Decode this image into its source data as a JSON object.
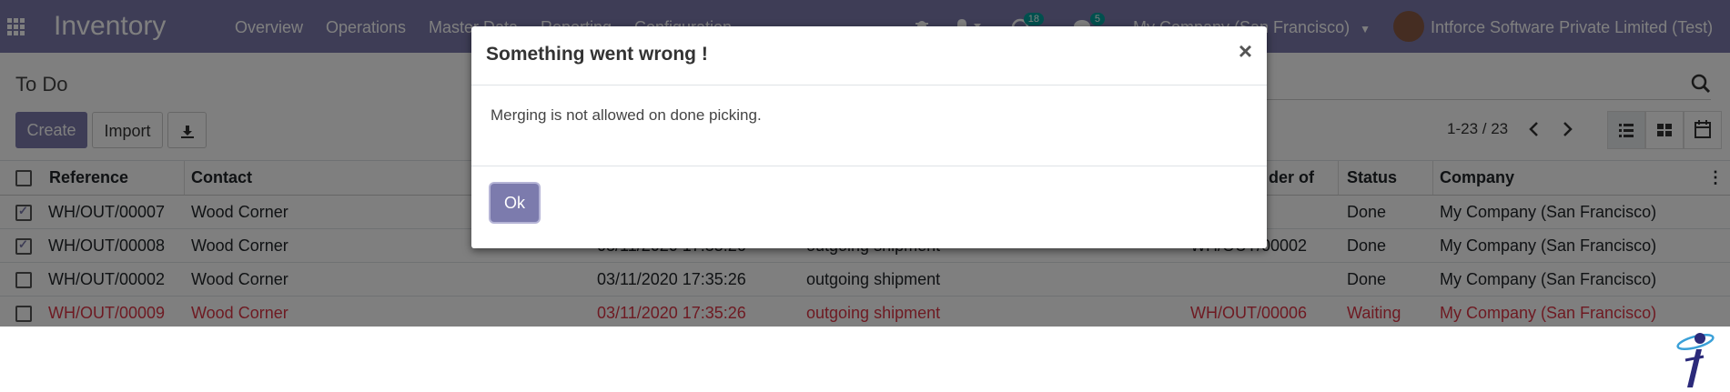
{
  "navbar": {
    "brand": "Inventory",
    "menu": [
      "Overview",
      "Operations",
      "Master Data",
      "Reporting",
      "Configuration"
    ],
    "activity_count": "18",
    "message_count": "5",
    "company_switcher": "My Company (San Francisco)",
    "user_name": "Intforce Software Private Limited (Test)"
  },
  "control_panel": {
    "breadcrumb": "To Do",
    "create_label": "Create",
    "import_label": "Import",
    "pager": "1-23 / 23"
  },
  "table": {
    "headers": [
      "Reference",
      "Contact",
      "der of",
      "Status",
      "Company"
    ],
    "rows": [
      {
        "reference": "WH/OUT/00007",
        "contact": "Wood Corner",
        "date": "",
        "operation": "",
        "origin": "",
        "status": "Done",
        "company": "My Company (San Francisco)"
      },
      {
        "reference": "WH/OUT/00008",
        "contact": "Wood Corner",
        "date": "03/11/2020 17:35:26",
        "operation": "outgoing shipment",
        "origin": "WH/OUT/00002",
        "status": "Done",
        "company": "My Company (San Francisco)"
      },
      {
        "reference": "WH/OUT/00002",
        "contact": "Wood Corner",
        "date": "03/11/2020 17:35:26",
        "operation": "outgoing shipment",
        "origin": "",
        "status": "Done",
        "company": "My Company (San Francisco)"
      },
      {
        "reference": "WH/OUT/00009",
        "contact": "Wood Corner",
        "date": "03/11/2020 17:35:26",
        "operation": "outgoing shipment",
        "origin": "WH/OUT/00006",
        "status": "Waiting",
        "company": "My Company (San Francisco)"
      }
    ]
  },
  "dialog": {
    "title": "Something went wrong !",
    "close_symbol": "×",
    "message": "Merging is not allowed on done picking.",
    "ok_label": "Ok"
  },
  "colors": {
    "brand": "#7c7bad",
    "waiting": "#dc3545",
    "badge": "#00a09d"
  }
}
